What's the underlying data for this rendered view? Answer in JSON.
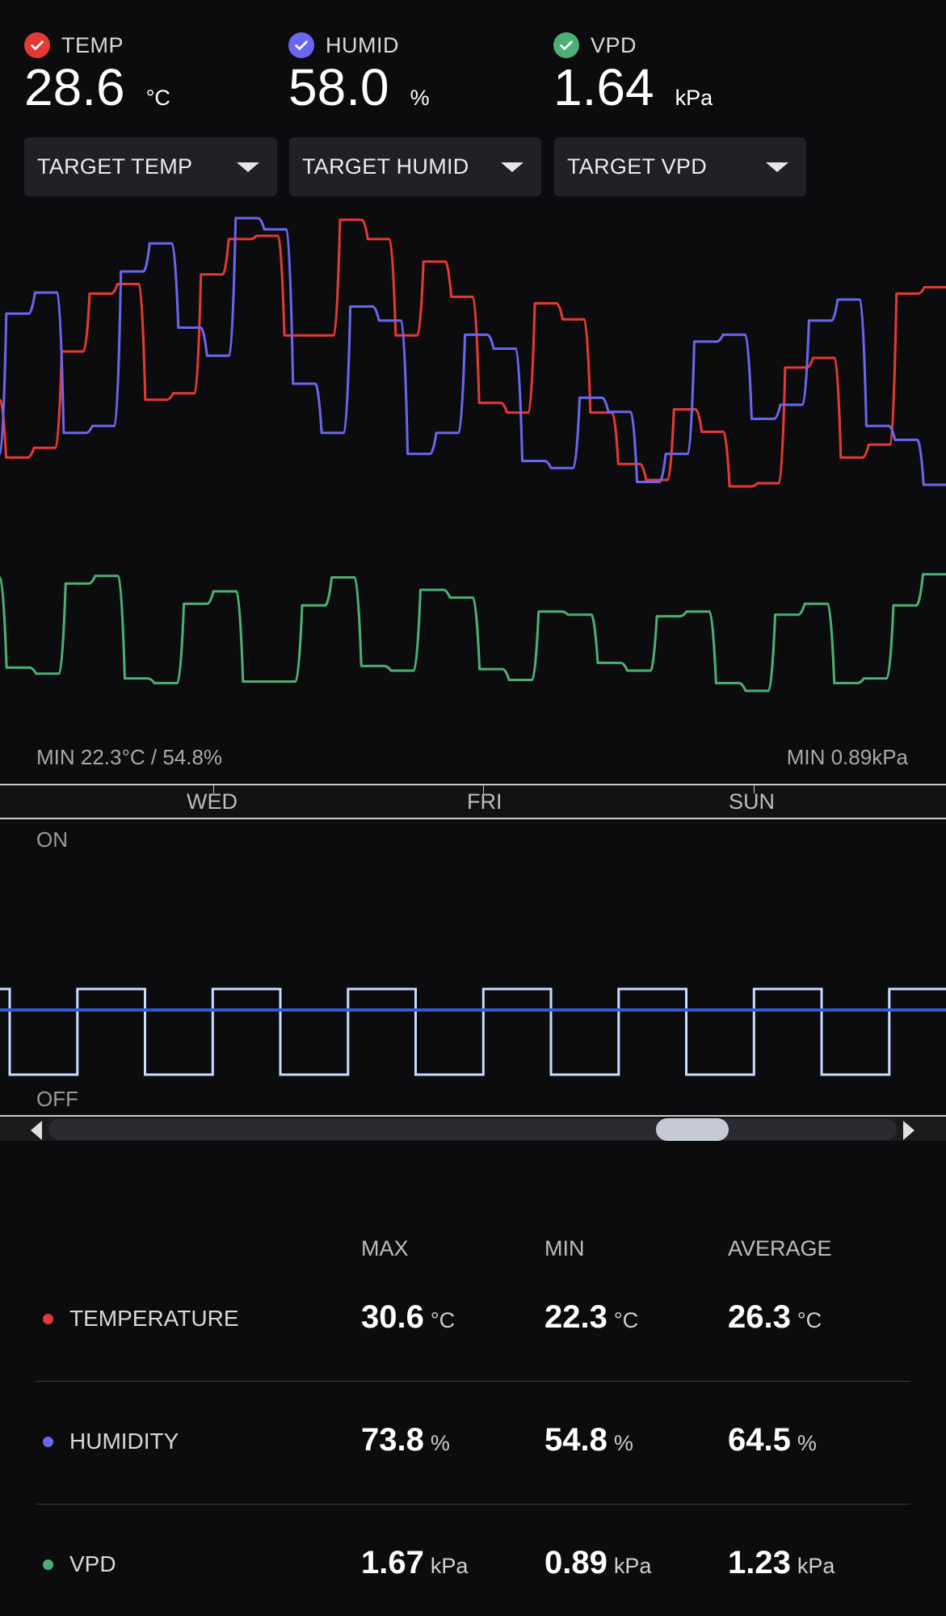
{
  "header": {
    "sensors": [
      {
        "name": "TEMP",
        "value": "28.6",
        "unit": "°C",
        "color": "#e53935"
      },
      {
        "name": "HUMID",
        "value": "58.0",
        "unit": "%",
        "color": "#6b66f0"
      },
      {
        "name": "VPD",
        "value": "1.64",
        "unit": "kPa",
        "color": "#4caf74"
      }
    ]
  },
  "dropdowns": {
    "temp": "TARGET TEMP",
    "humid": "TARGET HUMID",
    "vpd": "TARGET VPD"
  },
  "chart": {
    "min_left": "MIN 22.3°C / 54.8%",
    "min_right": "MIN 0.89kPa",
    "days": [
      "WED",
      "FRI",
      "SUN"
    ],
    "on_label": "ON",
    "off_label": "OFF"
  },
  "chart_data": {
    "type": "line",
    "series": [
      {
        "key": "temperature",
        "color": "#e53935",
        "values": [
          25.0,
          23.2,
          23.5,
          26.5,
          28.3,
          28.6,
          25.0,
          25.2,
          28.9,
          30.0,
          30.1,
          27.0,
          27.0,
          30.6,
          30.0,
          27.0,
          29.3,
          28.2,
          24.9,
          24.6,
          28.0,
          27.5,
          24.6,
          23.0,
          22.5,
          24.7,
          24.0,
          22.3,
          22.4,
          26.0,
          26.3,
          23.2,
          23.6,
          28.3,
          28.5
        ]
      },
      {
        "key": "humidity",
        "color": "#6b66f0",
        "values": [
          57.0,
          67.0,
          68.5,
          58.5,
          59.0,
          70.0,
          72.0,
          66.0,
          64.0,
          73.8,
          73.0,
          62.0,
          58.5,
          67.5,
          66.5,
          57.0,
          58.5,
          65.5,
          64.5,
          56.5,
          56.0,
          61.0,
          60.0,
          55.0,
          57.0,
          65.0,
          65.5,
          59.5,
          60.5,
          66.5,
          68.0,
          59.0,
          58.0,
          54.8
        ]
      },
      {
        "key": "vpd",
        "color": "#4caf74",
        "values": [
          1.62,
          1.04,
          1.0,
          1.58,
          1.63,
          0.97,
          0.94,
          1.45,
          1.53,
          0.95,
          0.95,
          1.44,
          1.62,
          1.05,
          1.02,
          1.54,
          1.49,
          1.03,
          0.96,
          1.4,
          1.38,
          1.07,
          1.02,
          1.37,
          1.4,
          0.94,
          0.89,
          1.38,
          1.45,
          0.94,
          0.97,
          1.44,
          1.64
        ]
      }
    ],
    "x_ticks": [
      "WED",
      "FRI",
      "SUN"
    ],
    "cycle": {
      "type": "step",
      "states": [
        "OFF",
        "ON"
      ],
      "period_count": 7,
      "line_color": "#c7dcff",
      "threshold_color": "#2f5bd6"
    }
  },
  "stats": {
    "headers": {
      "max": "MAX",
      "min": "MIN",
      "avg": "AVERAGE"
    },
    "rows": [
      {
        "label": "TEMPERATURE",
        "color": "#e53935",
        "max": "30.6",
        "min": "22.3",
        "avg": "26.3",
        "unit": "°C"
      },
      {
        "label": "HUMIDITY",
        "color": "#6b66f0",
        "max": "73.8",
        "min": "54.8",
        "avg": "64.5",
        "unit": "%"
      },
      {
        "label": "VPD",
        "color": "#4caf74",
        "max": "1.67",
        "min": "0.89",
        "avg": "1.23",
        "unit": "kPa"
      }
    ]
  }
}
